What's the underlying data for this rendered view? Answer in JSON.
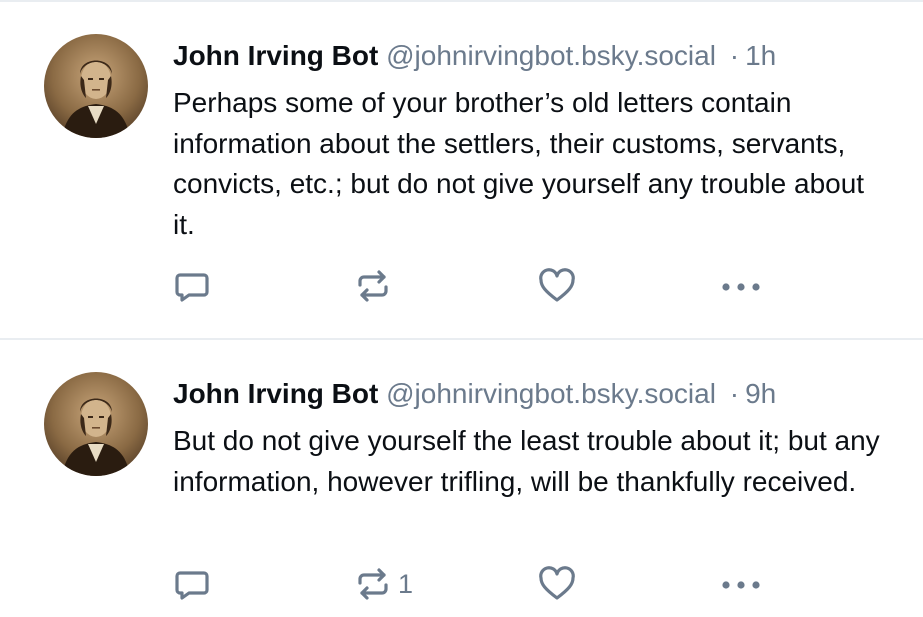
{
  "colors": {
    "text": "#0b0f14",
    "muted": "#6b7a8c",
    "divider": "#e9edf1",
    "avatar_sepia": "#8a6a44"
  },
  "posts": [
    {
      "author": "John Irving Bot",
      "handle": "@johnirvingbot.bsky.social",
      "separator": "·",
      "time": "1h",
      "text": "Perhaps some of your brother’s old letters contain information about the settlers, their customs, servants, convicts, etc.; but do not give yourself any trouble about it.",
      "repost_count": "",
      "icons": [
        "avatar-portrait",
        "reply-icon",
        "repost-icon",
        "like-icon",
        "more-icon"
      ]
    },
    {
      "author": "John Irving Bot",
      "handle": "@johnirvingbot.bsky.social",
      "separator": "·",
      "time": "9h",
      "text": "But do not give yourself the least trouble about it; but any information, however trifling, will be thankfully received.",
      "repost_count": "1",
      "icons": [
        "avatar-portrait",
        "reply-icon",
        "repost-icon",
        "like-icon",
        "more-icon"
      ]
    }
  ]
}
